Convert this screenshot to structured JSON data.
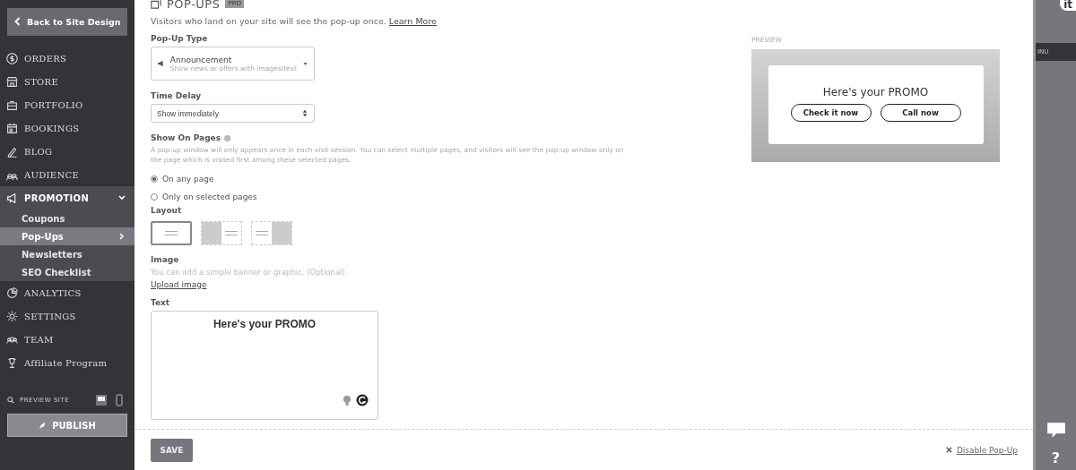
{
  "sidebar": {
    "back_button": "Back to Site Design",
    "items": [
      {
        "label": "ORDERS",
        "selected": false
      },
      {
        "label": "STORE",
        "selected": false
      },
      {
        "label": "PORTFOLIO",
        "selected": false
      },
      {
        "label": "BOOKINGS",
        "selected": false
      },
      {
        "label": "BLOG",
        "selected": false
      },
      {
        "label": "AUDIENCE",
        "selected": false
      },
      {
        "label": "PROMOTION",
        "selected": true,
        "expanded": true,
        "children": [
          {
            "label": "Coupons",
            "selected": false
          },
          {
            "label": "Pop-Ups",
            "selected": true
          },
          {
            "label": "Newsletters",
            "selected": false
          },
          {
            "label": "SEO Checklist",
            "selected": false
          }
        ]
      },
      {
        "label": "ANALYTICS",
        "selected": false
      },
      {
        "label": "SETTINGS",
        "selected": false
      },
      {
        "label": "TEAM",
        "selected": false
      },
      {
        "label": "Affiliate Program",
        "selected": false
      }
    ],
    "preview_site": "PREVIEW SITE",
    "publish": "PUBLISH"
  },
  "page": {
    "title": "POP-UPS",
    "badge": "PRO",
    "intro": "Visitors who land on your site will see the pop-up once.",
    "learn_more": "Learn More",
    "popup_type": {
      "label": "Pop-Up Type",
      "value": "Announcement",
      "description": "Show news or offers with images/text"
    },
    "time_delay": {
      "label": "Time Delay",
      "value": "Show immediately"
    },
    "show_on_pages": {
      "label": "Show On Pages",
      "help": "A pop-up window will only appears once in each visit session. You can select multiple pages, and visitors will see the pop-up window only on the page which is visited first among these selected pages.",
      "options": [
        {
          "label": "On any page",
          "selected": true
        },
        {
          "label": "Only on selected pages",
          "selected": false
        }
      ]
    },
    "layout": {
      "label": "Layout",
      "options": [
        {
          "kind": "center",
          "selected": true
        },
        {
          "kind": "image-left",
          "selected": false
        },
        {
          "kind": "image-right",
          "selected": false
        }
      ]
    },
    "image": {
      "label": "Image",
      "hint": "You can add a simple banner or graphic. (Optional)",
      "upload": "Upload image"
    },
    "text": {
      "label": "Text",
      "value": "Here's your PROMO"
    },
    "save": "SAVE",
    "disable": "Disable Pop-Up"
  },
  "preview": {
    "label": "PREVIEW",
    "heading": "Here's your PROMO",
    "buttons": [
      "Check it now",
      "Call now"
    ]
  },
  "right_rail": {
    "top_text": "it",
    "tab": "INU",
    "help": "?"
  }
}
